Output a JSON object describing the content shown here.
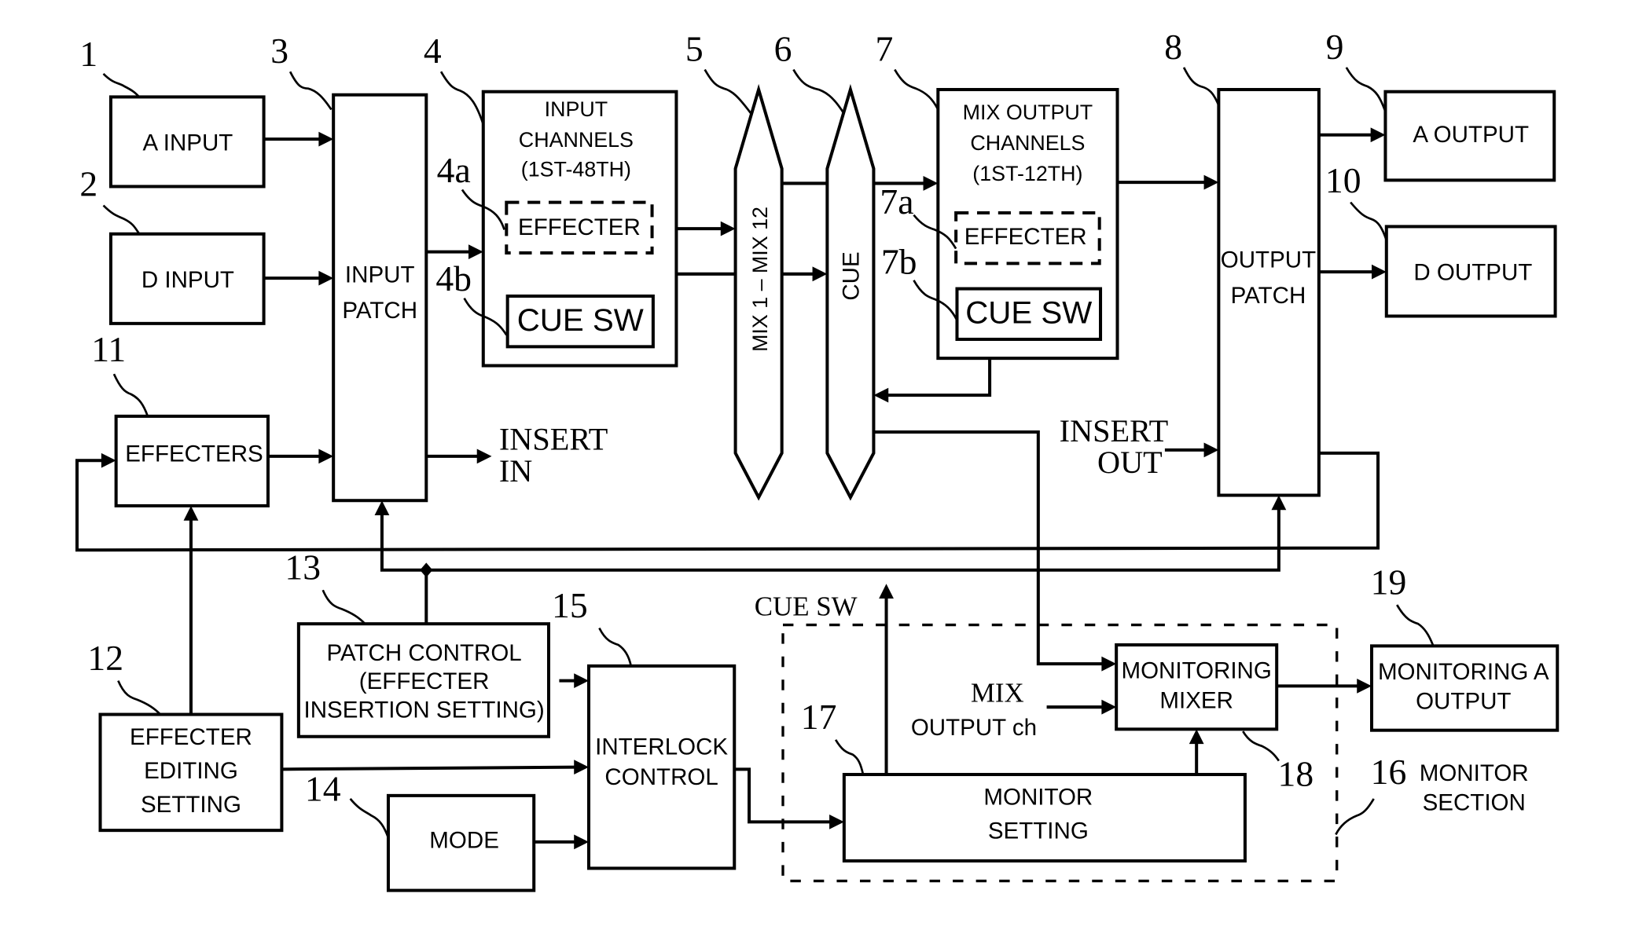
{
  "figure": {
    "blocks": {
      "a_input": {
        "ref": "1",
        "label": "A INPUT"
      },
      "d_input": {
        "ref": "2",
        "label": "D INPUT"
      },
      "input_patch": {
        "ref": "3",
        "line1": "INPUT",
        "line2": "PATCH"
      },
      "input_channels": {
        "ref": "4",
        "line1": "INPUT",
        "line2": "CHANNELS",
        "line3": "(1ST-48TH)",
        "effecter": {
          "ref": "4a",
          "label": "EFFECTER"
        },
        "cue_sw": {
          "ref": "4b",
          "label": "CUE SW"
        }
      },
      "mix_bus": {
        "ref": "5",
        "label": "MIX 1 – MIX 12"
      },
      "cue_bus": {
        "ref": "6",
        "label": "CUE"
      },
      "mix_output_channels": {
        "ref": "7",
        "line1": "MIX OUTPUT",
        "line2": "CHANNELS",
        "line3": "(1ST-12TH)",
        "effecter": {
          "ref": "7a",
          "label": "EFFECTER"
        },
        "cue_sw": {
          "ref": "7b",
          "label": "CUE SW"
        }
      },
      "output_patch": {
        "ref": "8",
        "line1": "OUTPUT",
        "line2": "PATCH"
      },
      "a_output": {
        "ref": "9",
        "label": "A OUTPUT"
      },
      "d_output": {
        "ref": "10",
        "label": "D OUTPUT"
      },
      "effecters": {
        "ref": "11",
        "label": "EFFECTERS"
      },
      "effecter_editing_setting": {
        "ref": "12",
        "line1": "EFFECTER",
        "line2": "EDITING",
        "line3": "SETTING"
      },
      "patch_control": {
        "ref": "13",
        "line1": "PATCH CONTROL",
        "line2": "(EFFECTER",
        "line3": "INSERTION SETTING)"
      },
      "mode": {
        "ref": "14",
        "label": "MODE"
      },
      "interlock_control": {
        "ref": "15",
        "line1": "INTERLOCK",
        "line2": "CONTROL"
      },
      "monitor_section": {
        "ref": "16",
        "line1": "MONITOR",
        "line2": "SECTION"
      },
      "monitor_setting": {
        "ref": "17",
        "line1": "MONITOR",
        "line2": "SETTING"
      },
      "monitoring_mixer": {
        "ref": "18",
        "line1": "MONITORING",
        "line2": "MIXER"
      },
      "monitoring_a_output": {
        "ref": "19",
        "line1": "MONITORING A",
        "line2": "OUTPUT"
      }
    },
    "signals": {
      "insert_in": {
        "line1": "INSERT",
        "line2": "IN"
      },
      "insert_out": {
        "line1": "INSERT",
        "line2": "OUT"
      },
      "cue_sw": "CUE SW",
      "mix_output_ch": {
        "line1": "MIX",
        "line2": "OUTPUT ch"
      }
    }
  }
}
